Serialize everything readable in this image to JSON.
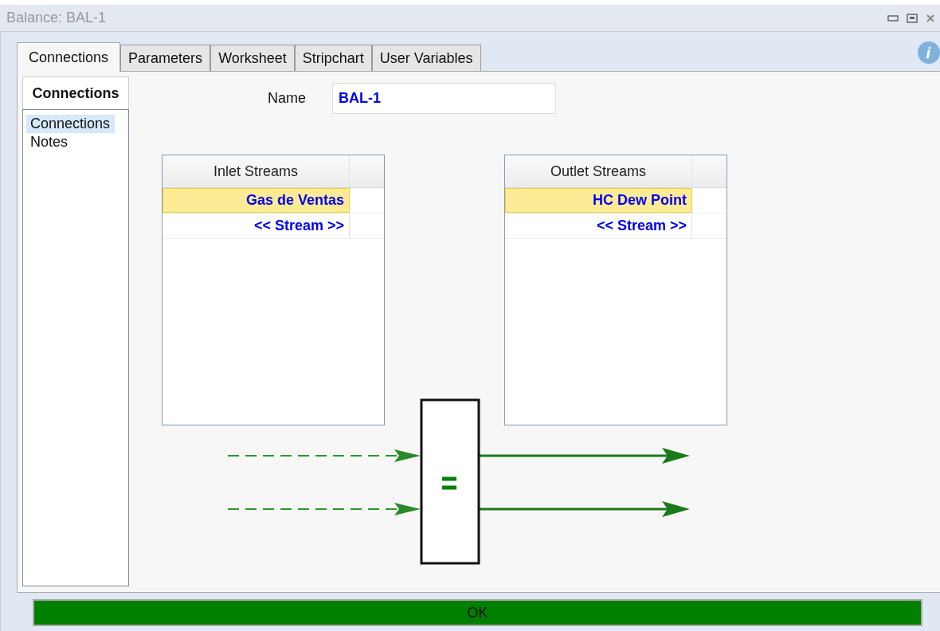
{
  "window": {
    "title": "Balance: BAL-1"
  },
  "tabs": [
    {
      "label": "Connections",
      "selected": true
    },
    {
      "label": "Parameters",
      "selected": false
    },
    {
      "label": "Worksheet",
      "selected": false
    },
    {
      "label": "Stripchart",
      "selected": false
    },
    {
      "label": "User Variables",
      "selected": false
    }
  ],
  "sidebar": {
    "heading": "Connections",
    "items": [
      {
        "label": "Connections",
        "selected": true
      },
      {
        "label": "Notes",
        "selected": false
      }
    ]
  },
  "name_field": {
    "label": "Name",
    "value": "BAL-1"
  },
  "inlet_table": {
    "columns": [
      "Inlet Streams"
    ],
    "rows": [
      {
        "stream": "Gas de Ventas",
        "selected": true
      },
      {
        "stream": "<< Stream >>",
        "selected": false
      }
    ]
  },
  "outlet_table": {
    "columns": [
      "Outlet Streams"
    ],
    "rows": [
      {
        "stream": "HC Dew Point",
        "selected": true
      },
      {
        "stream": "<< Stream >>",
        "selected": false
      }
    ]
  },
  "ok_button": {
    "label": "OK"
  }
}
